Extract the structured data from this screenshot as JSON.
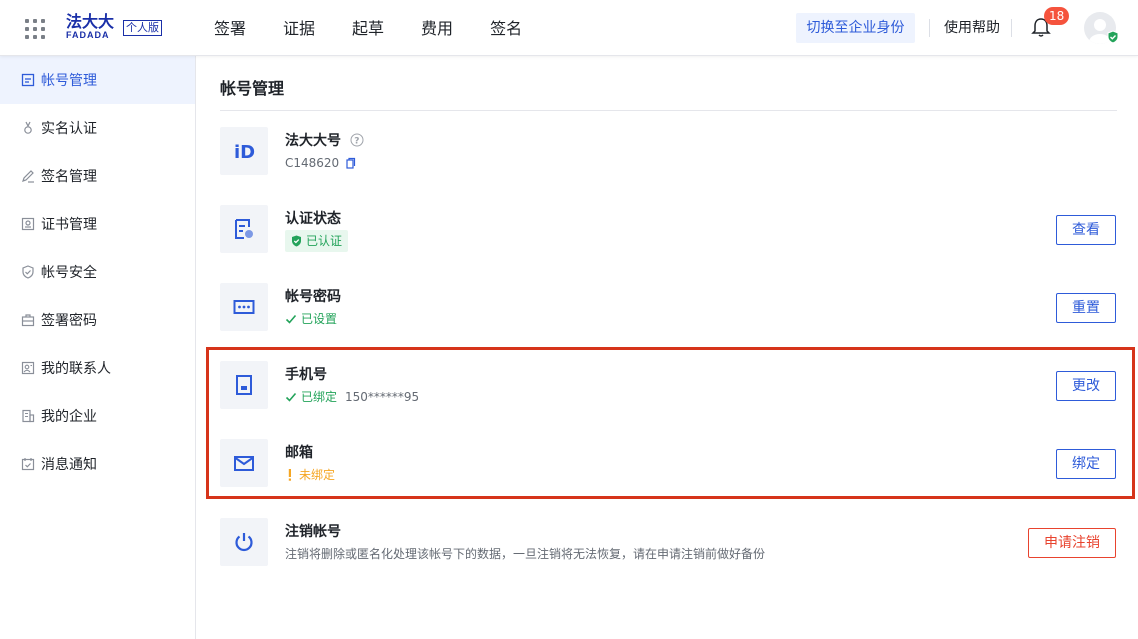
{
  "header": {
    "logo_text": "法大大",
    "logo_sub": "FADADA",
    "logo_badge": "个人版",
    "nav": [
      "签署",
      "证据",
      "起草",
      "费用",
      "签名"
    ],
    "switch_label": "切换至企业身份",
    "help_label": "使用帮助",
    "notification_count": "18"
  },
  "sidebar": {
    "items": [
      {
        "label": "帐号管理",
        "icon": "account-icon",
        "active": true
      },
      {
        "label": "实名认证",
        "icon": "medal-icon"
      },
      {
        "label": "签名管理",
        "icon": "pen-icon"
      },
      {
        "label": "证书管理",
        "icon": "certificate-icon"
      },
      {
        "label": "帐号安全",
        "icon": "shield-icon"
      },
      {
        "label": "签署密码",
        "icon": "briefcase-icon"
      },
      {
        "label": "我的联系人",
        "icon": "contacts-icon"
      },
      {
        "label": "我的企业",
        "icon": "building-icon"
      },
      {
        "label": "消息通知",
        "icon": "message-icon"
      }
    ]
  },
  "main": {
    "title": "帐号管理",
    "rows": {
      "account_id": {
        "title": "法大大号",
        "value": "C148620"
      },
      "verification": {
        "title": "认证状态",
        "status": "已认证",
        "button": "查看"
      },
      "password": {
        "title": "帐号密码",
        "status": "已设置",
        "button": "重置"
      },
      "phone": {
        "title": "手机号",
        "status": "已绑定",
        "value": "150******95",
        "button": "更改"
      },
      "email": {
        "title": "邮箱",
        "status": "未绑定",
        "button": "绑定"
      },
      "close_account": {
        "title": "注销帐号",
        "desc": "注销将删除或匿名化处理该帐号下的数据，一旦注销将无法恢复，请在申请注销前做好备份",
        "button": "申请注销"
      }
    }
  },
  "colors": {
    "accent": "#2e5bd9",
    "success": "#23a35a",
    "warning": "#f5a623",
    "danger": "#e8432e",
    "highlight": "#d6341a"
  }
}
